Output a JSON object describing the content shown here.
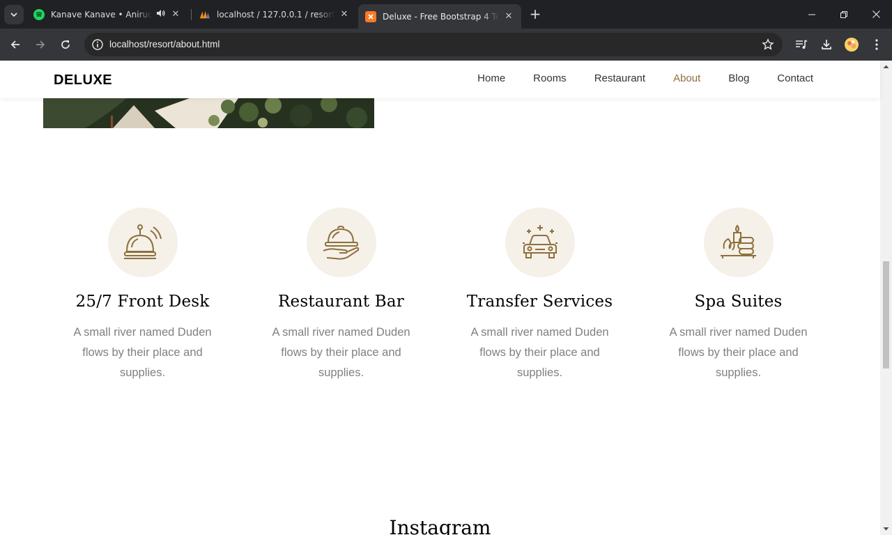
{
  "browser": {
    "tabs": [
      {
        "title": "Kanave Kanave • Anirudh Ravichander",
        "favicon": "spotify-icon",
        "audio": true
      },
      {
        "title": "localhost / 127.0.0.1 / resort / users",
        "favicon": "phpmyadmin-icon"
      },
      {
        "title": "Deluxe - Free Bootstrap 4 Template",
        "favicon": "xampp-icon",
        "active": true
      }
    ],
    "url": "localhost/resort/about.html"
  },
  "site": {
    "brand": "DELUXE",
    "nav": [
      "Home",
      "Rooms",
      "Restaurant",
      "About",
      "Blog",
      "Contact"
    ],
    "active_nav": "About",
    "accent_color": "#8d703b"
  },
  "services": [
    {
      "icon": "reception-bell-icon",
      "title": "25/7 Front Desk",
      "text": "A small river named Duden flows by their place and supplies."
    },
    {
      "icon": "serving-dish-icon",
      "title": "Restaurant Bar",
      "text": "A small river named Duden flows by their place and supplies."
    },
    {
      "icon": "car-icon",
      "title": "Transfer Services",
      "text": "A small river named Duden flows by their place and supplies."
    },
    {
      "icon": "spa-stones-icon",
      "title": "Spa Suites",
      "text": "A small river named Duden flows by their place and supplies."
    }
  ],
  "next_section_title": "Instagram"
}
